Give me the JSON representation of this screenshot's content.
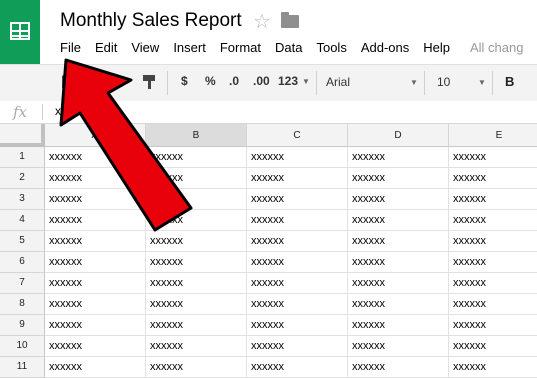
{
  "app": {
    "title": "Monthly Sales Report",
    "status": "All chang"
  },
  "menu": [
    "File",
    "Edit",
    "View",
    "Insert",
    "Format",
    "Data",
    "Tools",
    "Add-ons",
    "Help"
  ],
  "toolbar": {
    "currency": "$",
    "percent": "%",
    "decrease_decimals": ".0",
    "increase_decimals": ".00",
    "number_format": "123",
    "font": "Arial",
    "font_size": "10",
    "bold": "B"
  },
  "formula_bar": {
    "fx_label": "fx",
    "value": "xxxx"
  },
  "grid": {
    "columns": [
      "A",
      "B",
      "C",
      "D",
      "E"
    ],
    "rows": [
      "1",
      "2",
      "3",
      "4",
      "5",
      "6",
      "7",
      "8",
      "9",
      "10",
      "11"
    ],
    "cell_value": "xxxxxx"
  },
  "colors": {
    "logo_green": "#0f9d58",
    "arrow_red": "#e8000b"
  },
  "icons": [
    "sheets-logo-icon",
    "star-icon",
    "folder-icon",
    "print-icon",
    "undo-icon",
    "paint-format-icon",
    "fx-icon",
    "red-arrow-annotation"
  ]
}
